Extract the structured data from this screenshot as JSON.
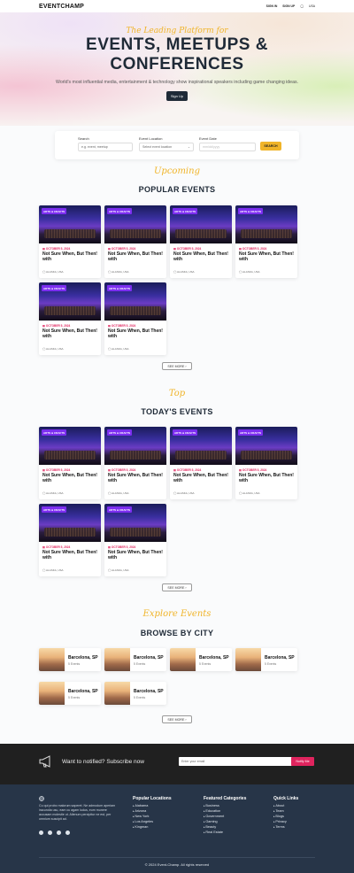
{
  "nav": {
    "logo": "EVENTCHAMP",
    "signin": "SIGN IN",
    "signup": "SIGN UP",
    "country": "USA"
  },
  "hero": {
    "script": "The Leading Platform for",
    "title_line1": "EVENTS, MEETUPS &",
    "title_line2": "CONFERENCES",
    "subtitle": "World's most influential media, entertainment & technology show inspirational speakers including game changing ideas.",
    "cta": "Sign Up"
  },
  "search": {
    "search_label": "Search",
    "search_placeholder": "e.g. event, meetup",
    "location_label": "Event Location",
    "location_value": "Select event location",
    "date_label": "Event Date",
    "date_placeholder": "mm/dd/yyyy",
    "button": "SEARCH"
  },
  "popular": {
    "script": "Upcoming",
    "title": "POPULAR EVENTS",
    "see_more": "SEE MORE",
    "cards": [
      {
        "badge": "ARTS & CRAFTS",
        "date": "OCTOBER 5, 2024",
        "title": "Not Sure When, But Then! with",
        "location": "ALASKA, USA"
      },
      {
        "badge": "ARTS & CRAFTS",
        "date": "OCTOBER 5, 2024",
        "title": "Not Sure When, But Then! with",
        "location": "ALASKA, USA"
      },
      {
        "badge": "ARTS & CRAFTS",
        "date": "OCTOBER 5, 2024",
        "title": "Not Sure When, But Then! with",
        "location": "ALASKA, USA"
      },
      {
        "badge": "ARTS & CRAFTS",
        "date": "OCTOBER 5, 2024",
        "title": "Not Sure When, But Then! with",
        "location": "ALASKA, USA"
      },
      {
        "badge": "ARTS & CRAFTS",
        "date": "OCTOBER 5, 2024",
        "title": "Not Sure When, But Then! with",
        "location": "ALASKA, USA"
      },
      {
        "badge": "ARTS & CRAFTS",
        "date": "OCTOBER 5, 2024",
        "title": "Not Sure When, But Then! with",
        "location": "ALASKA, USA"
      }
    ]
  },
  "today": {
    "script": "Top",
    "title": "TODAY'S EVENTS",
    "see_more": "SEE MORE",
    "cards": [
      {
        "badge": "ARTS & CRAFTS",
        "date": "OCTOBER 5, 2024",
        "title": "Not Sure When, But Then! with",
        "location": "ALASKA, USA"
      },
      {
        "badge": "ARTS & CRAFTS",
        "date": "OCTOBER 5, 2024",
        "title": "Not Sure When, But Then! with",
        "location": "ALASKA, USA"
      },
      {
        "badge": "ARTS & CRAFTS",
        "date": "OCTOBER 5, 2024",
        "title": "Not Sure When, But Then! with",
        "location": "ALASKA, USA"
      },
      {
        "badge": "ARTS & CRAFTS",
        "date": "OCTOBER 5, 2024",
        "title": "Not Sure When, But Then! with",
        "location": "ALASKA, USA"
      },
      {
        "badge": "ARTS & CRAFTS",
        "date": "OCTOBER 5, 2024",
        "title": "Not Sure When, But Then! with",
        "location": "ALASKA, USA"
      },
      {
        "badge": "ARTS & CRAFTS",
        "date": "OCTOBER 5, 2024",
        "title": "Not Sure When, But Then! with",
        "location": "ALASKA, USA"
      }
    ]
  },
  "cities": {
    "script": "Explore Events",
    "title": "BROWSE BY CITY",
    "see_more": "SEE MORE",
    "items": [
      {
        "name": "Barcelona, SP",
        "count": "5 Events"
      },
      {
        "name": "Barcelona, SP",
        "count": "5 Events"
      },
      {
        "name": "Barcelona, SP",
        "count": "5 Events"
      },
      {
        "name": "Barcelona, SP",
        "count": "5 Events"
      },
      {
        "name": "Barcelona, SP",
        "count": "5 Events"
      },
      {
        "name": "Barcelona, SP",
        "count": "5 Events"
      }
    ]
  },
  "subscribe": {
    "text": "Want to notified? Subscribe now",
    "placeholder": "Enter your email",
    "button": "Notify Me"
  },
  "footer": {
    "about": "Cu qui probo malorum saperet. Ne admodum aperiam iracundia usu, eam cu agam ludus, eum munere accusam molestie ut. Alienum percipitur ne est, per omnium suscipit ad.",
    "locations_title": "Popular Locations",
    "locations": [
      "Alabama",
      "Arizona",
      "New York",
      "Los Angeles",
      "Kingman"
    ],
    "categories_title": "Featured Categories",
    "categories": [
      "Business",
      "Education",
      "Government",
      "Gaming",
      "Beauty",
      "Real Estate"
    ],
    "links_title": "Quick Links",
    "links": [
      "About",
      "Team",
      "Blogs",
      "Privacy",
      "Terms"
    ],
    "copyright": "© 2024 Event-Champ. All rights reserved"
  },
  "colors": {
    "accent": "#f0b429",
    "brand_dark": "#1f2a37",
    "badge": "#7c2ef0",
    "date": "#e0245e",
    "footer_bg": "#273548"
  }
}
